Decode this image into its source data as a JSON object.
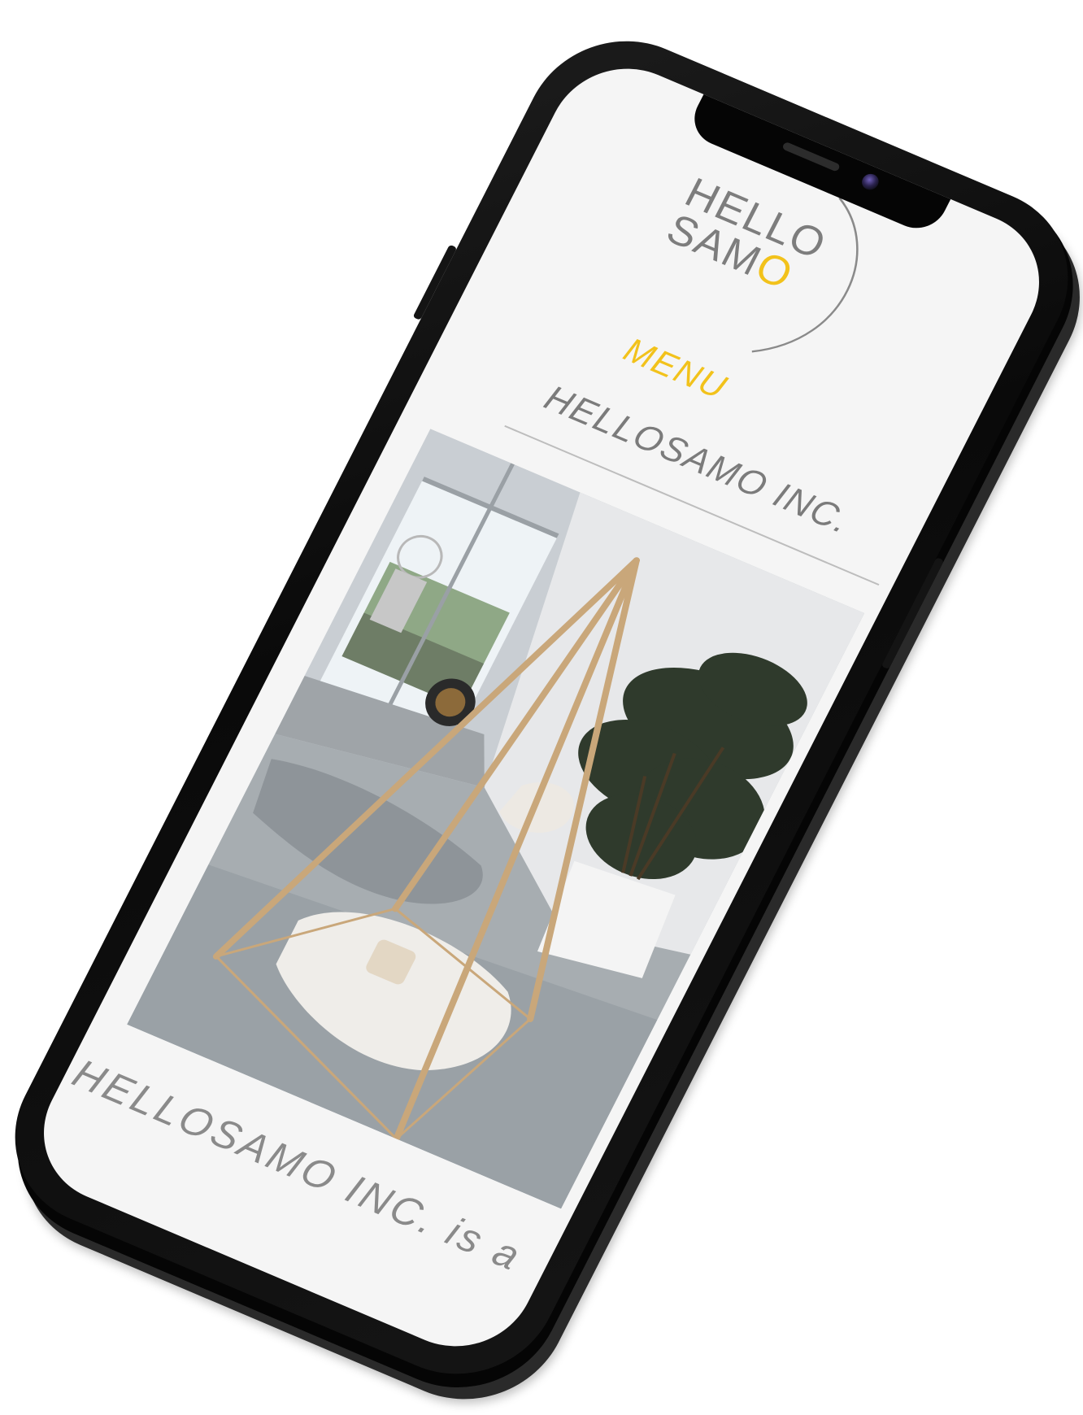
{
  "logo": {
    "line1": "HELLO",
    "line2_prefix": "SAM",
    "line2_accent": "O"
  },
  "nav": {
    "menu_label": "MENU"
  },
  "page": {
    "title": "HELLOSAMO INC.",
    "intro_text": "HELLOSAMO INC. is a"
  },
  "colors": {
    "accent": "#f2c21b",
    "text_gray": "#7b7b7b",
    "screen_bg": "#f5f5f5",
    "phone_body": "#0a0a0a"
  },
  "media": {
    "hero_photo": "interior-with-wooden-pyramid-frame-sheepskin-rug-and-palm"
  }
}
